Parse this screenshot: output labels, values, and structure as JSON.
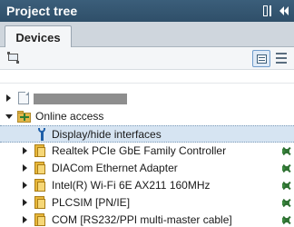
{
  "panel": {
    "title": "Project tree"
  },
  "tabs": [
    {
      "label": "Devices",
      "active": true
    }
  ],
  "toolbar": {
    "left_icon": "device-view-icon",
    "view_buttons": [
      "list-view-icon",
      "details-view-icon"
    ]
  },
  "tree": {
    "project_item": {
      "label": "",
      "redacted": true,
      "expanded": false
    },
    "online_access": {
      "label": "Online access",
      "expanded": true,
      "children": [
        {
          "label": "Display/hide interfaces",
          "icon": "wrench-icon",
          "selected": true,
          "has_expander": false,
          "status": false
        },
        {
          "label": "Realtek PCIe GbE Family Controller",
          "icon": "folder-icon",
          "selected": false,
          "has_expander": true,
          "status": true
        },
        {
          "label": "DIACom Ethernet Adapter",
          "icon": "folder-icon",
          "selected": false,
          "has_expander": true,
          "status": true
        },
        {
          "label": "Intel(R) Wi-Fi 6E AX211 160MHz",
          "icon": "folder-icon",
          "selected": false,
          "has_expander": true,
          "status": true
        },
        {
          "label": "PLCSIM [PN/IE]",
          "icon": "folder-icon",
          "selected": false,
          "has_expander": true,
          "status": true
        },
        {
          "label": "COM [RS232/PPI multi-master cable]",
          "icon": "folder-icon",
          "selected": false,
          "has_expander": true,
          "status": true
        }
      ]
    }
  },
  "colors": {
    "titlebar": "#2f4f69",
    "selection": "#d6e4f2",
    "folder": "#e8b73a",
    "status_green": "#3a8a3e"
  }
}
